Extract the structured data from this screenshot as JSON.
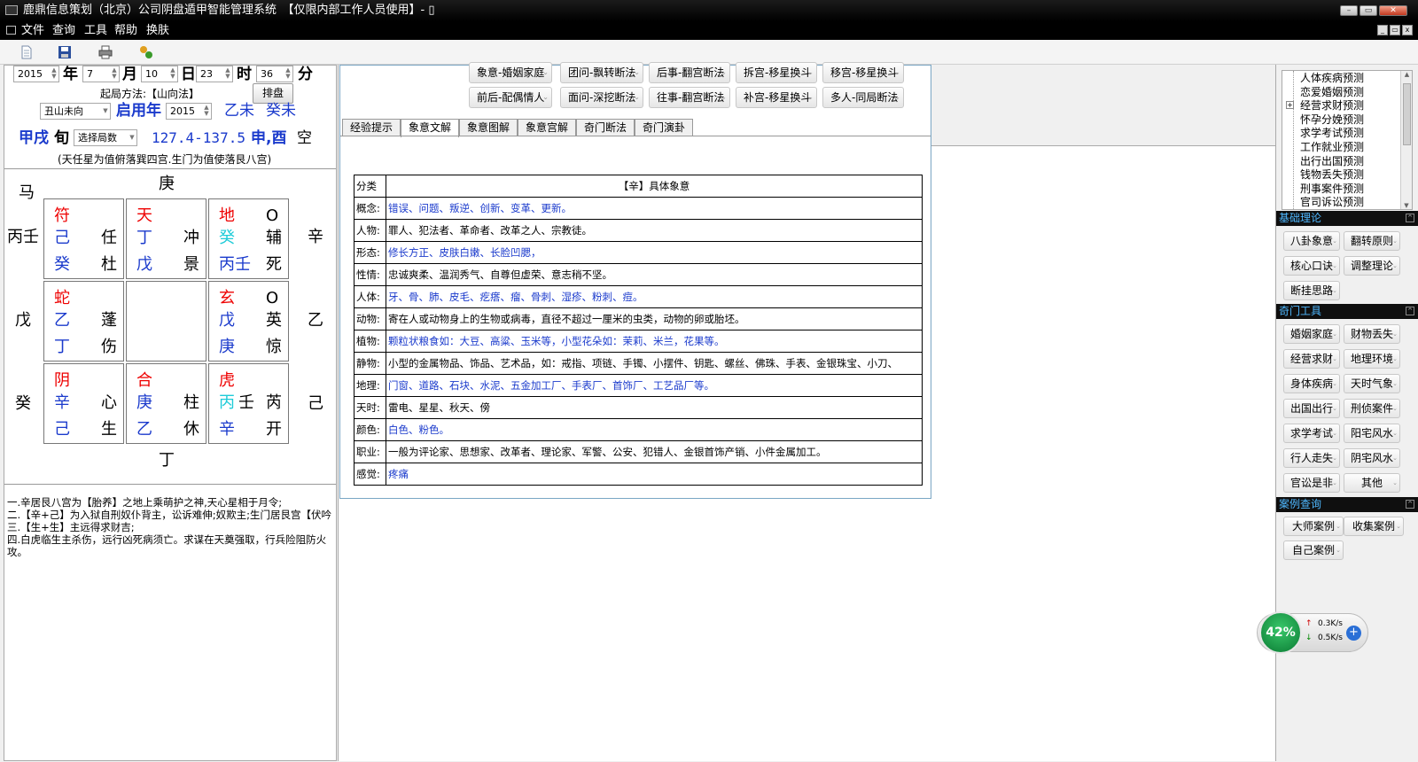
{
  "window": {
    "title": "鹿鼎信息策划（北京）公司阴盘遁甲智能管理系统　【仅限内部工作人员使用】- ▯"
  },
  "menu": {
    "items": [
      "文件",
      "查询",
      "工具",
      "帮助",
      "换肤"
    ]
  },
  "datetime": {
    "year": "2015",
    "year_label": "年",
    "month": "7",
    "month_label": "月",
    "day": "10",
    "day_label": "日",
    "hour": "23",
    "hour_label": "时",
    "minute": "36",
    "minute_label": "分"
  },
  "setup": {
    "method_label": "起局方法:【山向法】",
    "arrange_button": "排盘",
    "mountain": "丑山未向",
    "yong_label": "启用年",
    "yong_year": "2015",
    "ganzhi1": "乙未",
    "ganzhi2": "癸未",
    "xun": "甲戌",
    "xun_label": "旬",
    "select_ju": "选择局数",
    "degree": "127.4-137.5",
    "kong": "申,酉",
    "kong_label": "空",
    "info": "(天任星为值俯落巽四宫.生门为值使落艮八宫)"
  },
  "chart": {
    "top": "庚",
    "horse": "马",
    "bottom": "丁",
    "left": [
      "丙壬",
      "戊",
      "癸"
    ],
    "right": [
      "辛",
      "乙",
      "己"
    ],
    "cells": [
      {
        "god": "符",
        "circle": "",
        "r2a": "己",
        "r2b": "任",
        "r3a": "癸",
        "r3b": "杜"
      },
      {
        "god": "天",
        "circle": "",
        "r2a": "丁",
        "r2b": "冲",
        "r3a": "戊",
        "r3b": "景"
      },
      {
        "god": "地",
        "circle": "O",
        "r2a": "癸",
        "r2b": "辅",
        "r3a": "丙壬",
        "r3b": "死"
      },
      {
        "god": "蛇",
        "circle": "",
        "r2a": "乙",
        "r2b": "蓬",
        "r3a": "丁",
        "r3b": "伤"
      },
      {
        "god": "",
        "circle": "",
        "r2a": "",
        "r2b": "",
        "r3a": "",
        "r3b": ""
      },
      {
        "god": "玄",
        "circle": "O",
        "r2a": "戊",
        "r2b": "英",
        "r3a": "庚",
        "r3b": "惊"
      },
      {
        "god": "阴",
        "circle": "",
        "r2a": "辛",
        "r2b": "心",
        "r3a": "己",
        "r3b": "生"
      },
      {
        "god": "合",
        "circle": "",
        "r2a": "庚",
        "r2b": "柱",
        "r3a": "乙",
        "r3b": "休"
      },
      {
        "god": "虎",
        "circle": "",
        "r2a": "丙",
        "r2a2": "壬",
        "r2b": "芮",
        "r3a": "辛",
        "r3b": "开"
      }
    ]
  },
  "notes": [
    "一.辛居艮八宫为【胎养】之地上乘萌护之神,天心星相于月令;",
    "二.【辛+己】为入狱自刑奴仆背主，讼诉难伸;奴欺主;生门居艮宫【伏吟",
    "三.【生+生】主远得求财吉;",
    "四.白虎临生主杀伤，远行凶死病须亡。求谋在天奠强取，行兵险阻防火攻。"
  ],
  "mid": {
    "buttons_row1": [
      "象意-婚姻家庭",
      "团问-飘转断法",
      "后事-翻宫断法",
      "拆宫-移星换斗",
      "移宫-移星换斗"
    ],
    "buttons_row2": [
      "前后-配偶情人",
      "面问-深挖断法",
      "往事-翻宫断法",
      "补宫-移星换斗",
      "多人-同局断法"
    ],
    "tabs": [
      "经验提示",
      "象意文解",
      "象意图解",
      "象意宫解",
      "奇门断法",
      "奇门演卦"
    ],
    "table": {
      "h1": "分类",
      "h2": "【辛】具体象意",
      "rows": [
        {
          "k": "概念:",
          "v": "错误、问题、叛逆、创新、变革、更新。",
          "blue": true
        },
        {
          "k": "人物:",
          "v": "罪人、犯法者、革命者、改革之人、宗教徒。",
          "blue": false
        },
        {
          "k": "形态:",
          "v": "修长方正、皮肤白嫩、长脸凹腮，",
          "blue": true
        },
        {
          "k": "性情:",
          "v": "忠诚爽柔、温润秀气、自尊但虚荣、意志稍不坚。",
          "blue": false
        },
        {
          "k": "人体:",
          "v": "牙、骨、肺、皮毛、疙瘩、瘤、骨刺、湿疹、粉刺、痘。",
          "blue": true
        },
        {
          "k": "动物:",
          "v": "寄在人或动物身上的生物或病毒，直径不超过一厘米的虫类，动物的卵或胎坯。",
          "blue": false
        },
        {
          "k": "植物:",
          "v": "颗粒状粮食如：大豆、高粱、玉米等，小型花朵如：茉莉、米兰，花果等。",
          "blue": true
        },
        {
          "k": "静物:",
          "v": "小型的金属物品、饰品、艺术品，如：戒指、项链、手镯、小摆件、钥匙、螺丝、佛珠、手表、金银珠宝、小刀、",
          "blue": false
        },
        {
          "k": "地理:",
          "v": "门窗、道路、石块、水泥、五金加工厂、手表厂、首饰厂、工艺品厂等。",
          "blue": true
        },
        {
          "k": "天时:",
          "v": "雷电、星星、秋天、傍",
          "blue": false
        },
        {
          "k": "颜色:",
          "v": "白色、粉色。",
          "blue": true
        },
        {
          "k": "职业:",
          "v": "一般为评论家、思想家、改革者、理论家、军警、公安、犯错人、金银首饰产销、小件金属加工。",
          "blue": false
        },
        {
          "k": "感觉:",
          "v": "疼痛",
          "blue": true
        }
      ]
    }
  },
  "right": {
    "tree": [
      "人体疾病预测",
      "恋爱婚姻预测",
      "经营求财预测",
      "怀孕分娩预测",
      "求学考试预测",
      "工作就业预测",
      "出行出国预测",
      "钱物丢失预测",
      "刑事案件预测",
      "官司诉讼预测"
    ],
    "sections": {
      "theory": "基础理论",
      "tools": "奇门工具",
      "cases": "案例查询"
    },
    "theory_buttons": [
      "八卦象意",
      "翻转原则",
      "核心口诀",
      "调整理论",
      "断挂思路"
    ],
    "tool_buttons": [
      "婚姻家庭",
      "财物丢失",
      "经营求财",
      "地理环境",
      "身体疾病",
      "天时气象",
      "出国出行",
      "刑侦案件",
      "求学考试",
      "阳宅风水",
      "行人走失",
      "阴宅风水",
      "官讼是非",
      "其他"
    ],
    "case_buttons": [
      "大师案例",
      "收集案例",
      "自己案例"
    ]
  },
  "net": {
    "percent": "42%",
    "up": "0.3K/s",
    "down": "0.5K/s"
  },
  "colors": {
    "god": "#e00000",
    "blue": "#1a3acc",
    "cyan": "#1ecbd8",
    "section_text": "#4fb8ff"
  }
}
